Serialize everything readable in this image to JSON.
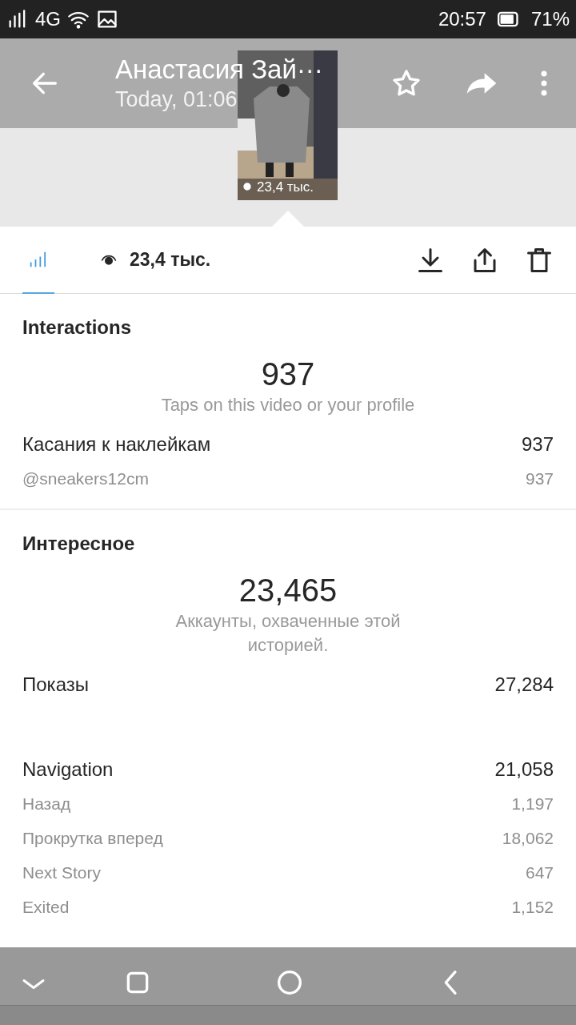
{
  "status_bar": {
    "network": "4G",
    "time": "20:57",
    "battery": "71%"
  },
  "header": {
    "title": "Анастасия Зай···",
    "subtitle": "Today, 01:06"
  },
  "thumbnail": {
    "kind": "picture",
    "views": "23,4 тыс."
  },
  "toolbar": {
    "views": "23,4 тыс."
  },
  "sections": [
    {
      "title": "Interactions",
      "total": "937",
      "caption": "Taps on this video or your profile",
      "groups": [
        [
          {
            "kind": "main",
            "label": "Касания к наклейкам",
            "value": "937"
          },
          {
            "kind": "sub",
            "label": "@sneakers12cm",
            "value": "937"
          }
        ]
      ]
    },
    {
      "title": "Интересное",
      "total": "23,465",
      "caption": "Аккаунты, охваченные этой историей.",
      "groups": [
        [
          {
            "kind": "main",
            "label": "Показы",
            "value": "27,284"
          }
        ],
        [
          {
            "kind": "main",
            "label": "Navigation",
            "value": "21,058"
          },
          {
            "kind": "sub",
            "label": "Назад",
            "value": "1,197"
          },
          {
            "kind": "sub",
            "label": "Прокрутка вперед",
            "value": "18,062"
          },
          {
            "kind": "sub",
            "label": "Next Story",
            "value": "647"
          },
          {
            "kind": "sub",
            "label": "Exited",
            "value": "1,152"
          }
        ]
      ]
    }
  ]
}
